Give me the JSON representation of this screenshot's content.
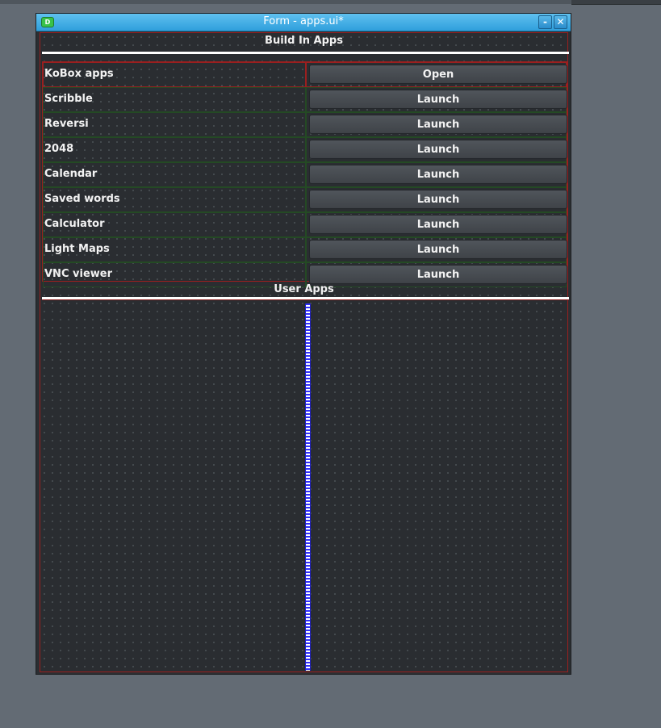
{
  "window": {
    "title": "Form - apps.ui*",
    "icon_label": "D",
    "minimize_label": "-",
    "close_label": "✕"
  },
  "builtin": {
    "heading": "Build In Apps",
    "apps": [
      {
        "name": "KoBox apps",
        "action": "Open"
      },
      {
        "name": "Scribble",
        "action": "Launch"
      },
      {
        "name": "Reversi",
        "action": "Launch"
      },
      {
        "name": "2048",
        "action": "Launch"
      },
      {
        "name": "Calendar",
        "action": "Launch"
      },
      {
        "name": "Saved words",
        "action": "Launch"
      },
      {
        "name": "Calculator",
        "action": "Launch"
      },
      {
        "name": "Light Maps",
        "action": "Launch"
      },
      {
        "name": "VNC viewer",
        "action": "Launch"
      }
    ]
  },
  "user": {
    "heading": "User Apps"
  },
  "colors": {
    "titlebar": "#3aaee6",
    "background": "#2a2d31",
    "layout_border": "#9b1f1f",
    "splitter": "#3030ff"
  }
}
